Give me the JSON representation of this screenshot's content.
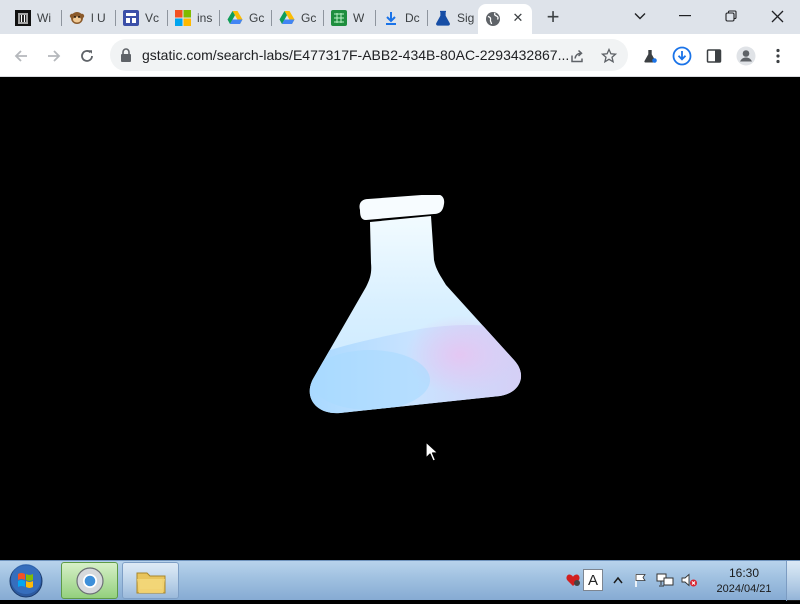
{
  "tabs": [
    {
      "title": "Wi",
      "icon": "library-icon"
    },
    {
      "title": "l U",
      "icon": "monkey-icon"
    },
    {
      "title": "Vc",
      "icon": "window-icon"
    },
    {
      "title": "ins",
      "icon": "microsoft-icon"
    },
    {
      "title": "Gc",
      "icon": "google-drive-icon"
    },
    {
      "title": "Gc",
      "icon": "google-drive-icon"
    },
    {
      "title": "W",
      "icon": "spreadsheet-icon"
    },
    {
      "title": "Dc",
      "icon": "download-icon"
    },
    {
      "title": "Sig",
      "icon": "labs-flask-icon"
    },
    {
      "title": "",
      "icon": "globe-icon"
    }
  ],
  "toolbar": {
    "url": "gstatic.com/search-labs/E477317F-ABB2-434B-80AC-2293432867..."
  },
  "taskbar": {
    "time": "16:30",
    "date": "2024/04/21",
    "ime_label": "A"
  },
  "colors": {
    "tabstrip": "#dee3ea",
    "page_background": "#000000",
    "flask_top": "#dff3ff",
    "flask_liquid": "#b8dcff",
    "flask_pink": "#e9c9f2"
  }
}
